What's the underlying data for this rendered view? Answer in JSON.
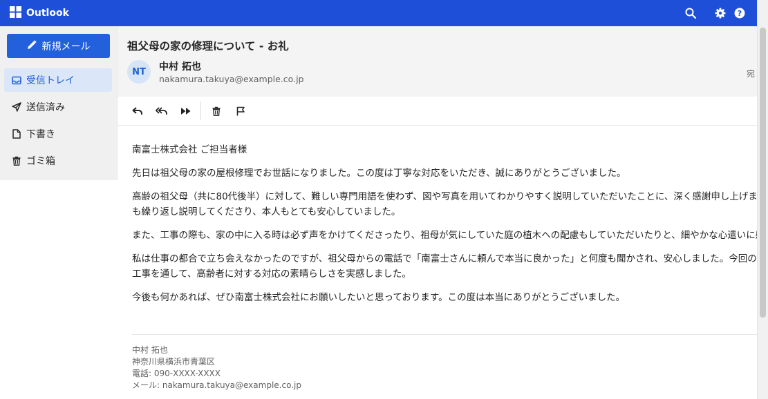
{
  "app": {
    "title": "Outlook",
    "icon": "waffle-grid-icon"
  },
  "topbar": {
    "icons": [
      "search-icon",
      "gear-icon",
      "help-icon"
    ]
  },
  "sidebar": {
    "compose_label": "新規メール",
    "items": [
      {
        "label": "受信トレイ",
        "icon": "inbox-icon",
        "active": true
      },
      {
        "label": "送信済み",
        "icon": "send-icon",
        "active": false
      },
      {
        "label": "下書き",
        "icon": "draft-icon",
        "active": false
      },
      {
        "label": "ゴミ箱",
        "icon": "trash-icon",
        "active": false
      }
    ]
  },
  "message": {
    "subject": "祖父母の家の修理について - お礼",
    "sender_initials": "NT",
    "sender_name": "中村 拓也",
    "sender_email": "nakamura.takuya@example.co.jp",
    "to_label": "宛",
    "body": [
      "南富士株式会社 ご担当者様",
      "先日は祖父母の家の屋根修理でお世話になりました。この度は丁寧な対応をいただき、誠にありがとうございました。",
      "高齢の祖父母（共に80代後半）に対して、難しい専門用語を使わず、図や写真を用いてわかりやすく説明していただいたことに、深く感謝申し上げます。耳が遠いのですが、何度も繰り返し説明してくださり、本人もとても安心していました。",
      "また、工事の際も、家の中に入る時は必ず声をかけてくださったり、祖母が気にしていた庭の植木への配慮もしていただいたりと、細やかな心遣いに感動しました。",
      "私は仕事の都合で立ち会えなかったのですが、祖父母からの電話で「南富士さんに頼んで本当に良かった」と何度も聞かされ、安心しました。今回の工事を通して、高齢者に対する対応の素晴らしさを実感しました。",
      "今後も何かあれば、ぜひ南富士株式会社にお願いしたいと思っております。この度は本当にありがとうございました。"
    ],
    "signature": {
      "name": "中村 拓也",
      "address": "神奈川県横浜市青葉区",
      "phone": "電話: 090-XXXX-XXXX",
      "email": "メール: nakamura.takuya@example.co.jp"
    }
  },
  "toolbar": {
    "icons": [
      "reply-icon",
      "reply-all-icon",
      "forward-icon",
      "delete-icon",
      "flag-icon"
    ]
  },
  "colors": {
    "brand": "#1e4fd8",
    "compose": "#2360dc",
    "active_nav_bg": "#dbe7f8",
    "active_nav_text": "#1e5fd6"
  }
}
